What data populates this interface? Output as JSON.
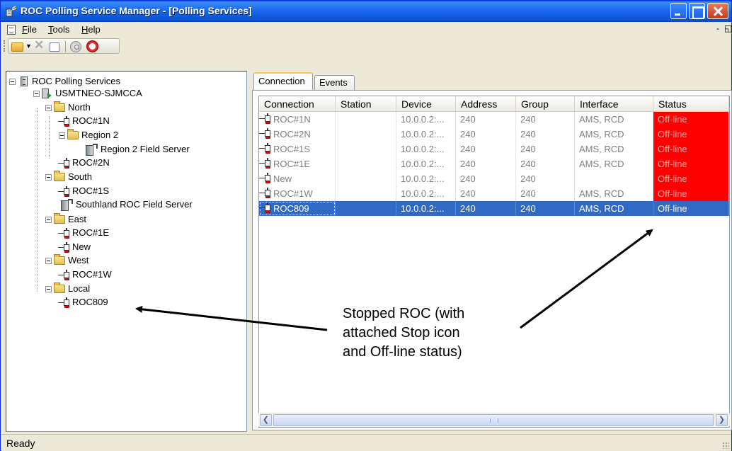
{
  "window": {
    "title": "ROC Polling Service Manager - [Polling Services]"
  },
  "menu": {
    "file": "File",
    "tools": "Tools",
    "help": "Help",
    "mdi_controls": "-  ȳ"
  },
  "toolbar": {
    "icons": [
      "open-folder-icon",
      "dropdown-arrow-icon",
      "delete-icon",
      "properties-icon",
      "start-icon",
      "stop-icon"
    ]
  },
  "tree": {
    "root": "ROC Polling Services",
    "host": "USMTNEO-SJMCCA",
    "north": "North",
    "roc1n": "ROC#1N",
    "region2": "Region 2",
    "region2_server": "Region 2 Field Server",
    "roc2n": "ROC#2N",
    "south": "South",
    "roc1s": "ROC#1S",
    "southland_server": "Southland ROC Field Server",
    "east": "East",
    "roc1e": "ROC#1E",
    "new": "New",
    "west": "West",
    "roc1w": "ROC#1W",
    "local": "Local",
    "roc809": "ROC809"
  },
  "tabs": {
    "connection": "Connection",
    "events": "Events"
  },
  "table": {
    "columns": [
      "Connection",
      "Station",
      "Device",
      "Address",
      "Group",
      "Interface",
      "Status"
    ],
    "rows": [
      {
        "connection": "ROC#1N",
        "station": "",
        "device": "10.0.0.2:...",
        "address": "240",
        "group": "240",
        "interface": "AMS, RCD",
        "status": "Off-line"
      },
      {
        "connection": "ROC#2N",
        "station": "",
        "device": "10.0.0.2:...",
        "address": "240",
        "group": "240",
        "interface": "AMS, RCD",
        "status": "Off-line"
      },
      {
        "connection": "ROC#1S",
        "station": "",
        "device": "10.0.0.2:...",
        "address": "240",
        "group": "240",
        "interface": "AMS, RCD",
        "status": "Off-line"
      },
      {
        "connection": "ROC#1E",
        "station": "",
        "device": "10.0.0.2:...",
        "address": "240",
        "group": "240",
        "interface": "AMS, RCD",
        "status": "Off-line"
      },
      {
        "connection": "New",
        "station": "",
        "device": "10.0.0.2:...",
        "address": "240",
        "group": "240",
        "interface": "",
        "status": "Off-line"
      },
      {
        "connection": "ROC#1W",
        "station": "",
        "device": "10.0.0.2:...",
        "address": "240",
        "group": "240",
        "interface": "AMS, RCD",
        "status": "Off-line"
      },
      {
        "connection": "ROC809",
        "station": "",
        "device": "10.0.0.2:...",
        "address": "240",
        "group": "240",
        "interface": "AMS, RCD",
        "status": "Off-line"
      }
    ],
    "selected_row": "ROC809",
    "status_color": "#ff0000",
    "selection_color": "#316ac5"
  },
  "statusbar": {
    "text": "Ready"
  },
  "annotation": {
    "line1": "Stopped ROC (with",
    "line2": "attached Stop icon",
    "line3": "and Off-line status)"
  }
}
